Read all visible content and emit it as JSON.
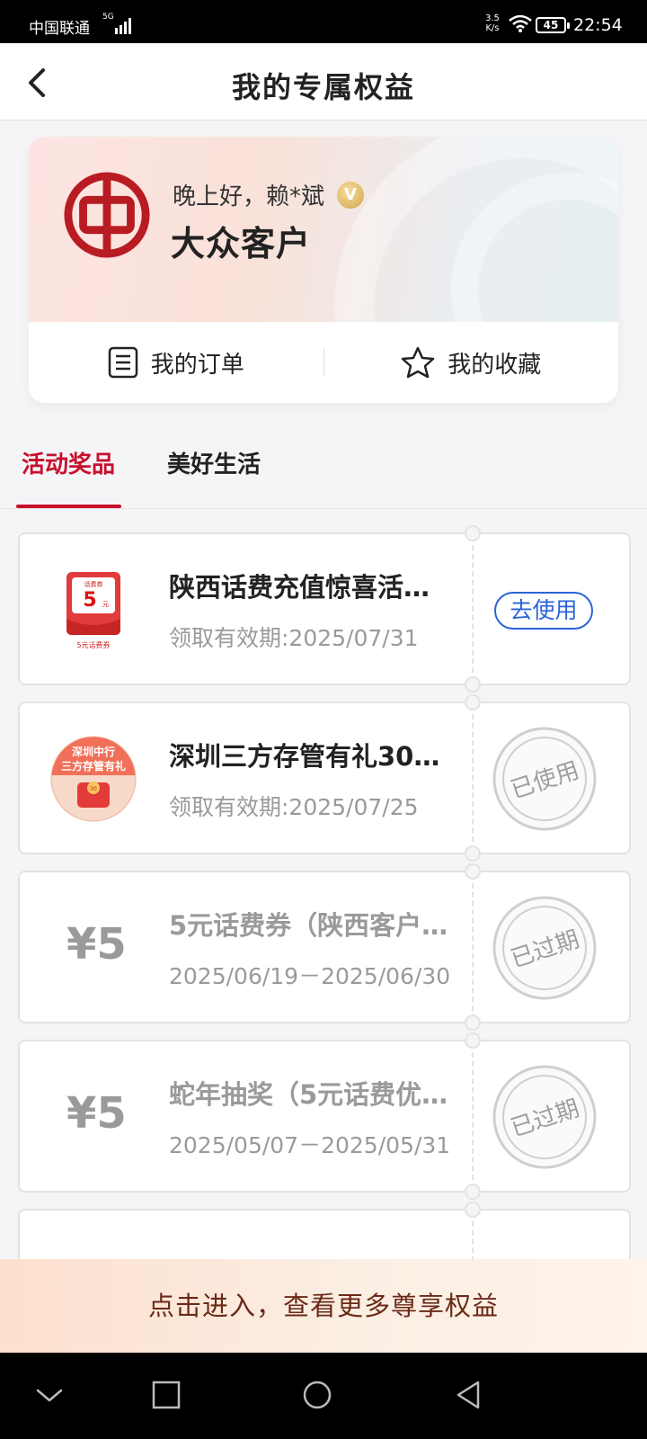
{
  "status_bar": {
    "carrier": "中国联通",
    "network": "5G",
    "speed": [
      "3.5",
      "K/s"
    ],
    "battery": "45",
    "time": "22:54"
  },
  "header": {
    "title": "我的专属权益",
    "back_icon": "chevron-left-icon"
  },
  "profile": {
    "greeting": "晚上好，赖*斌",
    "badge": "V",
    "level": "大众客户",
    "logo": "boc-logo",
    "links": [
      {
        "label": "我的订单",
        "icon": "order-list-icon"
      },
      {
        "label": "我的收藏",
        "icon": "star-icon"
      }
    ]
  },
  "tabs": [
    {
      "label": "活动奖品",
      "active": true
    },
    {
      "label": "美好生活",
      "active": false
    }
  ],
  "coupons": [
    {
      "title": "陕西话费充值惊喜活…",
      "date": "领取有效期:2025/07/31",
      "action": "去使用",
      "image": "phone-voucher-icon",
      "image_text": [
        "话费券",
        "5",
        "元",
        "5元话费券"
      ]
    },
    {
      "title": "深圳三方存管有礼30…",
      "date": "领取有效期:2025/07/25",
      "stamp": "已使用",
      "image": "promo-red-envelope-icon",
      "image_text": [
        "深圳中行",
        "三方存管有礼",
        "30"
      ]
    },
    {
      "amount": "¥5",
      "title": "5元话费券（陕西客户…",
      "date": "2025/06/19－2025/06/30",
      "stamp": "已过期"
    },
    {
      "amount": "¥5",
      "title": "蛇年抽奖（5元话费优…",
      "date": "2025/05/07－2025/05/31",
      "stamp": "已过期"
    }
  ],
  "banner": {
    "label": "点击进入，查看更多尊享权益"
  },
  "system_nav": [
    "chevron-down-icon",
    "square-icon",
    "circle-icon",
    "triangle-back-icon"
  ],
  "colors": {
    "accent": "#c8102e",
    "link_blue": "#2b64d8",
    "muted": "#9a9a9a"
  }
}
